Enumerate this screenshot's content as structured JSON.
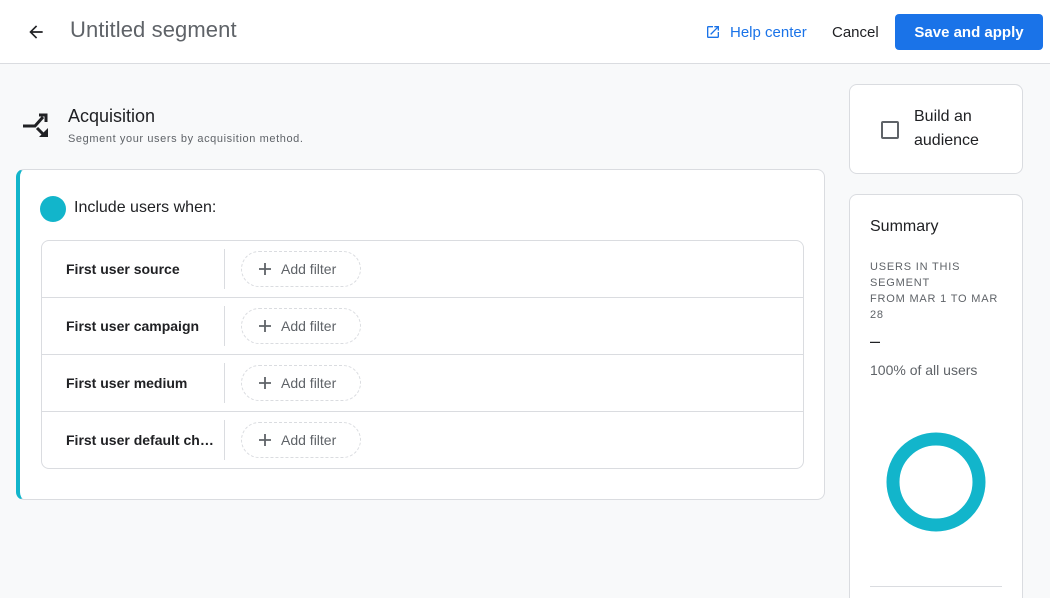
{
  "header": {
    "back_icon": "arrow-back-icon",
    "title": "Untitled segment",
    "help_icon": "open-in-new-icon",
    "help_label": "Help center",
    "cancel_label": "Cancel",
    "save_label": "Save and apply"
  },
  "section": {
    "icon": "merge-type-icon",
    "title": "Acquisition",
    "description": "Segment your users by acquisition method."
  },
  "include": {
    "label": "Include users when:",
    "accent_color": "#12b5cb",
    "rows": [
      {
        "dimension": "First user source",
        "action_label": "Add filter"
      },
      {
        "dimension": "First user campaign",
        "action_label": "Add filter"
      },
      {
        "dimension": "First user medium",
        "action_label": "Add filter"
      },
      {
        "dimension": "First user default channel group",
        "display": "First user default c...",
        "action_label": "Add filter"
      }
    ]
  },
  "audience": {
    "checked": false,
    "label": "Build an audience"
  },
  "summary": {
    "title": "Summary",
    "meta_line1": "Users in this segment",
    "meta_line2": "From Mar 1 to Mar 28",
    "value": "–",
    "percent_label": "100% of all users",
    "percent_value": 100,
    "donut_color": "#12b5cb"
  },
  "colors": {
    "primary": "#1a73e8",
    "accent": "#12b5cb"
  }
}
